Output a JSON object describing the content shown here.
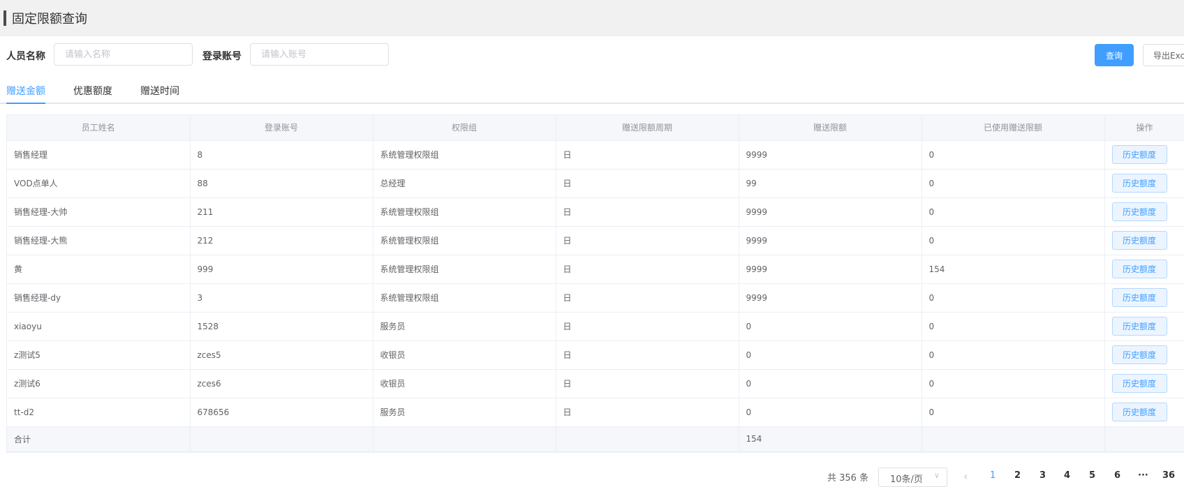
{
  "page": {
    "title": "固定限额查询"
  },
  "filters": {
    "name_label": "人员名称",
    "name_placeholder": "请输入名称",
    "account_label": "登录账号",
    "account_placeholder": "请输入账号",
    "query_label": "查询",
    "export_label": "导出Excel"
  },
  "tabs": [
    "赠送金额",
    "优惠额度",
    "赠送时间"
  ],
  "active_tab": 0,
  "table": {
    "headers": [
      "员工姓名",
      "登录账号",
      "权限组",
      "赠送限额周期",
      "赠送限额",
      "已使用赠送限额",
      "操作"
    ],
    "rows": [
      [
        "销售经理",
        "8",
        "系统管理权限组",
        "日",
        "9999",
        "0"
      ],
      [
        "VOD点单人",
        "88",
        "总经理",
        "日",
        "99",
        "0"
      ],
      [
        "销售经理-大帅",
        "211",
        "系统管理权限组",
        "日",
        "9999",
        "0"
      ],
      [
        "销售经理-大熊",
        "212",
        "系统管理权限组",
        "日",
        "9999",
        "0"
      ],
      [
        "黄",
        "999",
        "系统管理权限组",
        "日",
        "9999",
        "154"
      ],
      [
        "销售经理-dy",
        "3",
        "系统管理权限组",
        "日",
        "9999",
        "0"
      ],
      [
        "xiaoyu",
        "1528",
        "服务员",
        "日",
        "0",
        "0"
      ],
      [
        "z测试5",
        "zces5",
        "收银员",
        "日",
        "0",
        "0"
      ],
      [
        "z测试6",
        "zces6",
        "收银员",
        "日",
        "0",
        "0"
      ],
      [
        "tt-d2",
        "678656",
        "服务员",
        "日",
        "0",
        "0"
      ]
    ],
    "action_label": "历史额度",
    "summary": {
      "label": "合计",
      "value": "154"
    }
  },
  "pagination": {
    "total_text": "共 356 条",
    "page_size": "10条/页",
    "pages": [
      "1",
      "2",
      "3",
      "4",
      "5",
      "6",
      "···",
      "36"
    ],
    "current": "1"
  },
  "colors": {
    "accent": "#409eff",
    "title_bar": "#f1f1f1",
    "header_bg": "#f5f7fa"
  }
}
